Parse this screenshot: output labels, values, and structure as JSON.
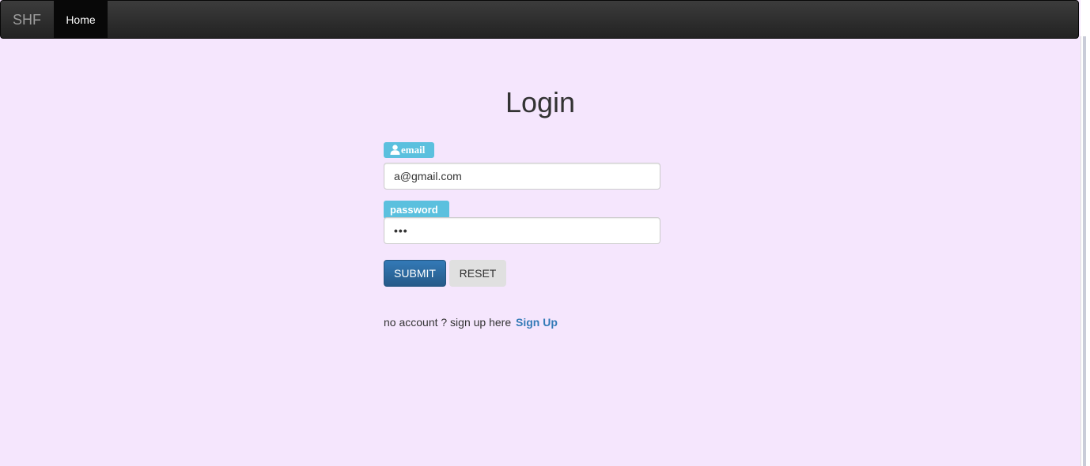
{
  "navbar": {
    "brand": "SHF",
    "home_label": "Home"
  },
  "login": {
    "title": "Login",
    "email_label": "email",
    "email_value": "a@gmail.com",
    "password_label": "password",
    "password_value": "•••",
    "submit_label": "SUBMIT",
    "reset_label": "RESET",
    "signup_prompt": "no account ? sign up here",
    "signup_link": "Sign Up"
  },
  "icons": {
    "email_label_icon": "user-icon"
  },
  "colors": {
    "page_background": "#f5e6fd",
    "label_background": "#5bc0de",
    "primary_button": "#337ab7",
    "link": "#337ab7",
    "navbar": "#222222"
  }
}
